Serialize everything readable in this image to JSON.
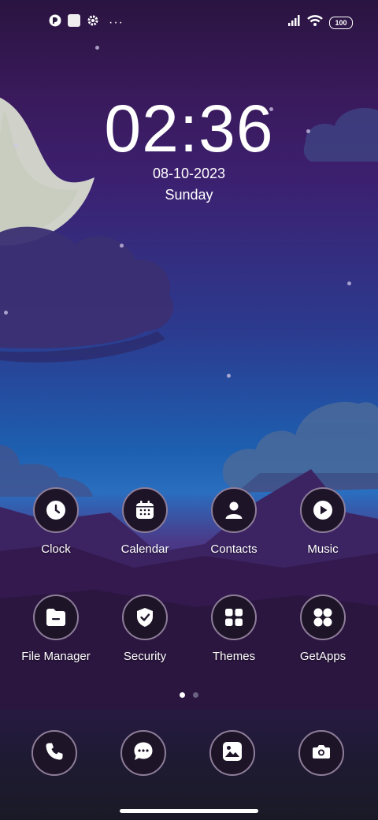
{
  "status_bar": {
    "left_icons": [
      "app-notification-icon",
      "square-notification-icon",
      "settings-gear-icon",
      "more-dots-icon"
    ],
    "more_text": "···",
    "right_icons": [
      "signal-icon",
      "wifi-icon",
      "battery-icon"
    ],
    "battery_level": "100"
  },
  "clock_widget": {
    "time": "02:36",
    "date": "08-10-2023",
    "day": "Sunday"
  },
  "apps": [
    {
      "label": "Clock",
      "icon": "clock-icon"
    },
    {
      "label": "Calendar",
      "icon": "calendar-icon"
    },
    {
      "label": "Contacts",
      "icon": "contacts-icon"
    },
    {
      "label": "Music",
      "icon": "music-play-icon"
    },
    {
      "label": "File Manager",
      "icon": "folder-icon"
    },
    {
      "label": "Security",
      "icon": "shield-icon"
    },
    {
      "label": "Themes",
      "icon": "themes-grid-icon"
    },
    {
      "label": "GetApps",
      "icon": "getapps-icon"
    }
  ],
  "page_indicator": {
    "pages": 2,
    "current": 1
  },
  "dock": [
    {
      "icon": "phone-icon"
    },
    {
      "icon": "messages-icon"
    },
    {
      "icon": "gallery-icon"
    },
    {
      "icon": "camera-icon"
    }
  ],
  "colors": {
    "icon_bg": "#1d1428",
    "icon_border": "#8e7d99",
    "sky_top": "#2a1440",
    "sky_mid": "#1d5fb0"
  }
}
